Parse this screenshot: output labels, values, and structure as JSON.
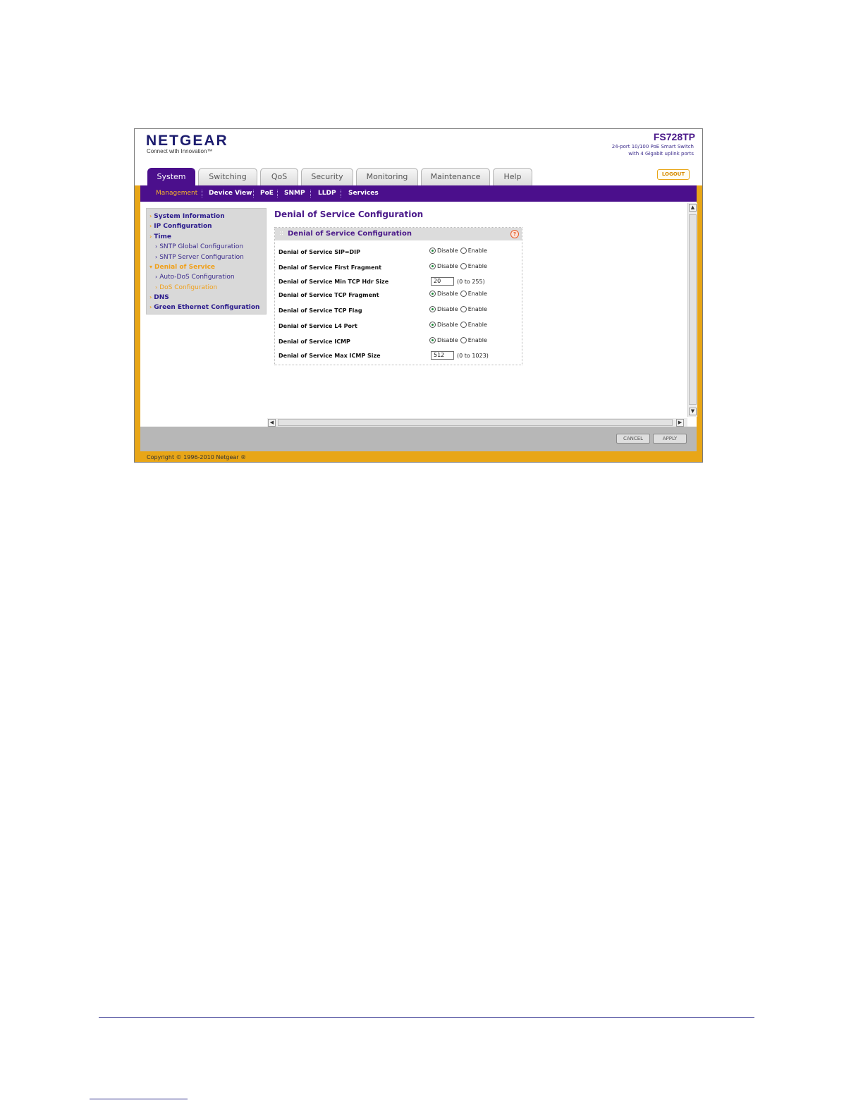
{
  "header": {
    "logo": "NETGEAR",
    "tagline": "Connect with Innovation™",
    "model": "FS728TP",
    "description_line1": "24-port 10/100 PoE Smart Switch",
    "description_line2": "with 4 Gigabit uplink ports",
    "logout_label": "LOGOUT"
  },
  "tabs": [
    {
      "label": "System",
      "active": true
    },
    {
      "label": "Switching"
    },
    {
      "label": "QoS"
    },
    {
      "label": "Security"
    },
    {
      "label": "Monitoring"
    },
    {
      "label": "Maintenance"
    },
    {
      "label": "Help"
    }
  ],
  "subnav": [
    {
      "label": "Management",
      "active": true
    },
    {
      "label": "Device View"
    },
    {
      "label": "PoE"
    },
    {
      "label": "SNMP"
    },
    {
      "label": "LLDP"
    },
    {
      "label": "Services"
    }
  ],
  "sidebar": [
    {
      "label": "System Information"
    },
    {
      "label": "IP Configuration"
    },
    {
      "label": "Time"
    },
    {
      "label": "SNTP Global Configuration"
    },
    {
      "label": "SNTP Server Configuration"
    },
    {
      "label": "Denial of Service",
      "active": true
    },
    {
      "label": "Auto-DoS Configuration"
    },
    {
      "label": "DoS Configuration",
      "active": true
    },
    {
      "label": "DNS"
    },
    {
      "label": "Green Ethernet Configuration"
    }
  ],
  "main": {
    "page_title": "Denial of Service Configuration",
    "panel_title": "Denial of Service Configuration",
    "help_icon": "?",
    "disable_label": "Disable",
    "enable_label": "Enable",
    "rows": [
      {
        "label": "Denial of Service SIP=DIP",
        "selected": "Disable"
      },
      {
        "label": "Denial of Service First Fragment",
        "selected": "Disable"
      },
      {
        "label": "Denial of Service Min TCP Hdr Size",
        "value": "20",
        "range": "(0 to 255)"
      },
      {
        "label": "Denial of Service TCP Fragment",
        "selected": "Disable"
      },
      {
        "label": "Denial of Service TCP Flag",
        "selected": "Disable"
      },
      {
        "label": "Denial of Service L4 Port",
        "selected": "Disable"
      },
      {
        "label": "Denial of Service ICMP",
        "selected": "Disable"
      },
      {
        "label": "Denial of Service Max ICMP Size",
        "value": "512",
        "range": "(0 to 1023)"
      }
    ]
  },
  "buttons": {
    "cancel": "CANCEL",
    "apply": "APPLY"
  },
  "copyright": "Copyright © 1996-2010 Netgear ®",
  "icons": {
    "scroll_up": "up-arrow-icon",
    "scroll_down": "down-arrow-icon",
    "scroll_left": "left-arrow-icon",
    "scroll_right": "right-arrow-icon"
  },
  "colors": {
    "brand_purple": "#4b0f8c",
    "accent_orange": "#e8a617",
    "active_link": "#f0a01a"
  }
}
